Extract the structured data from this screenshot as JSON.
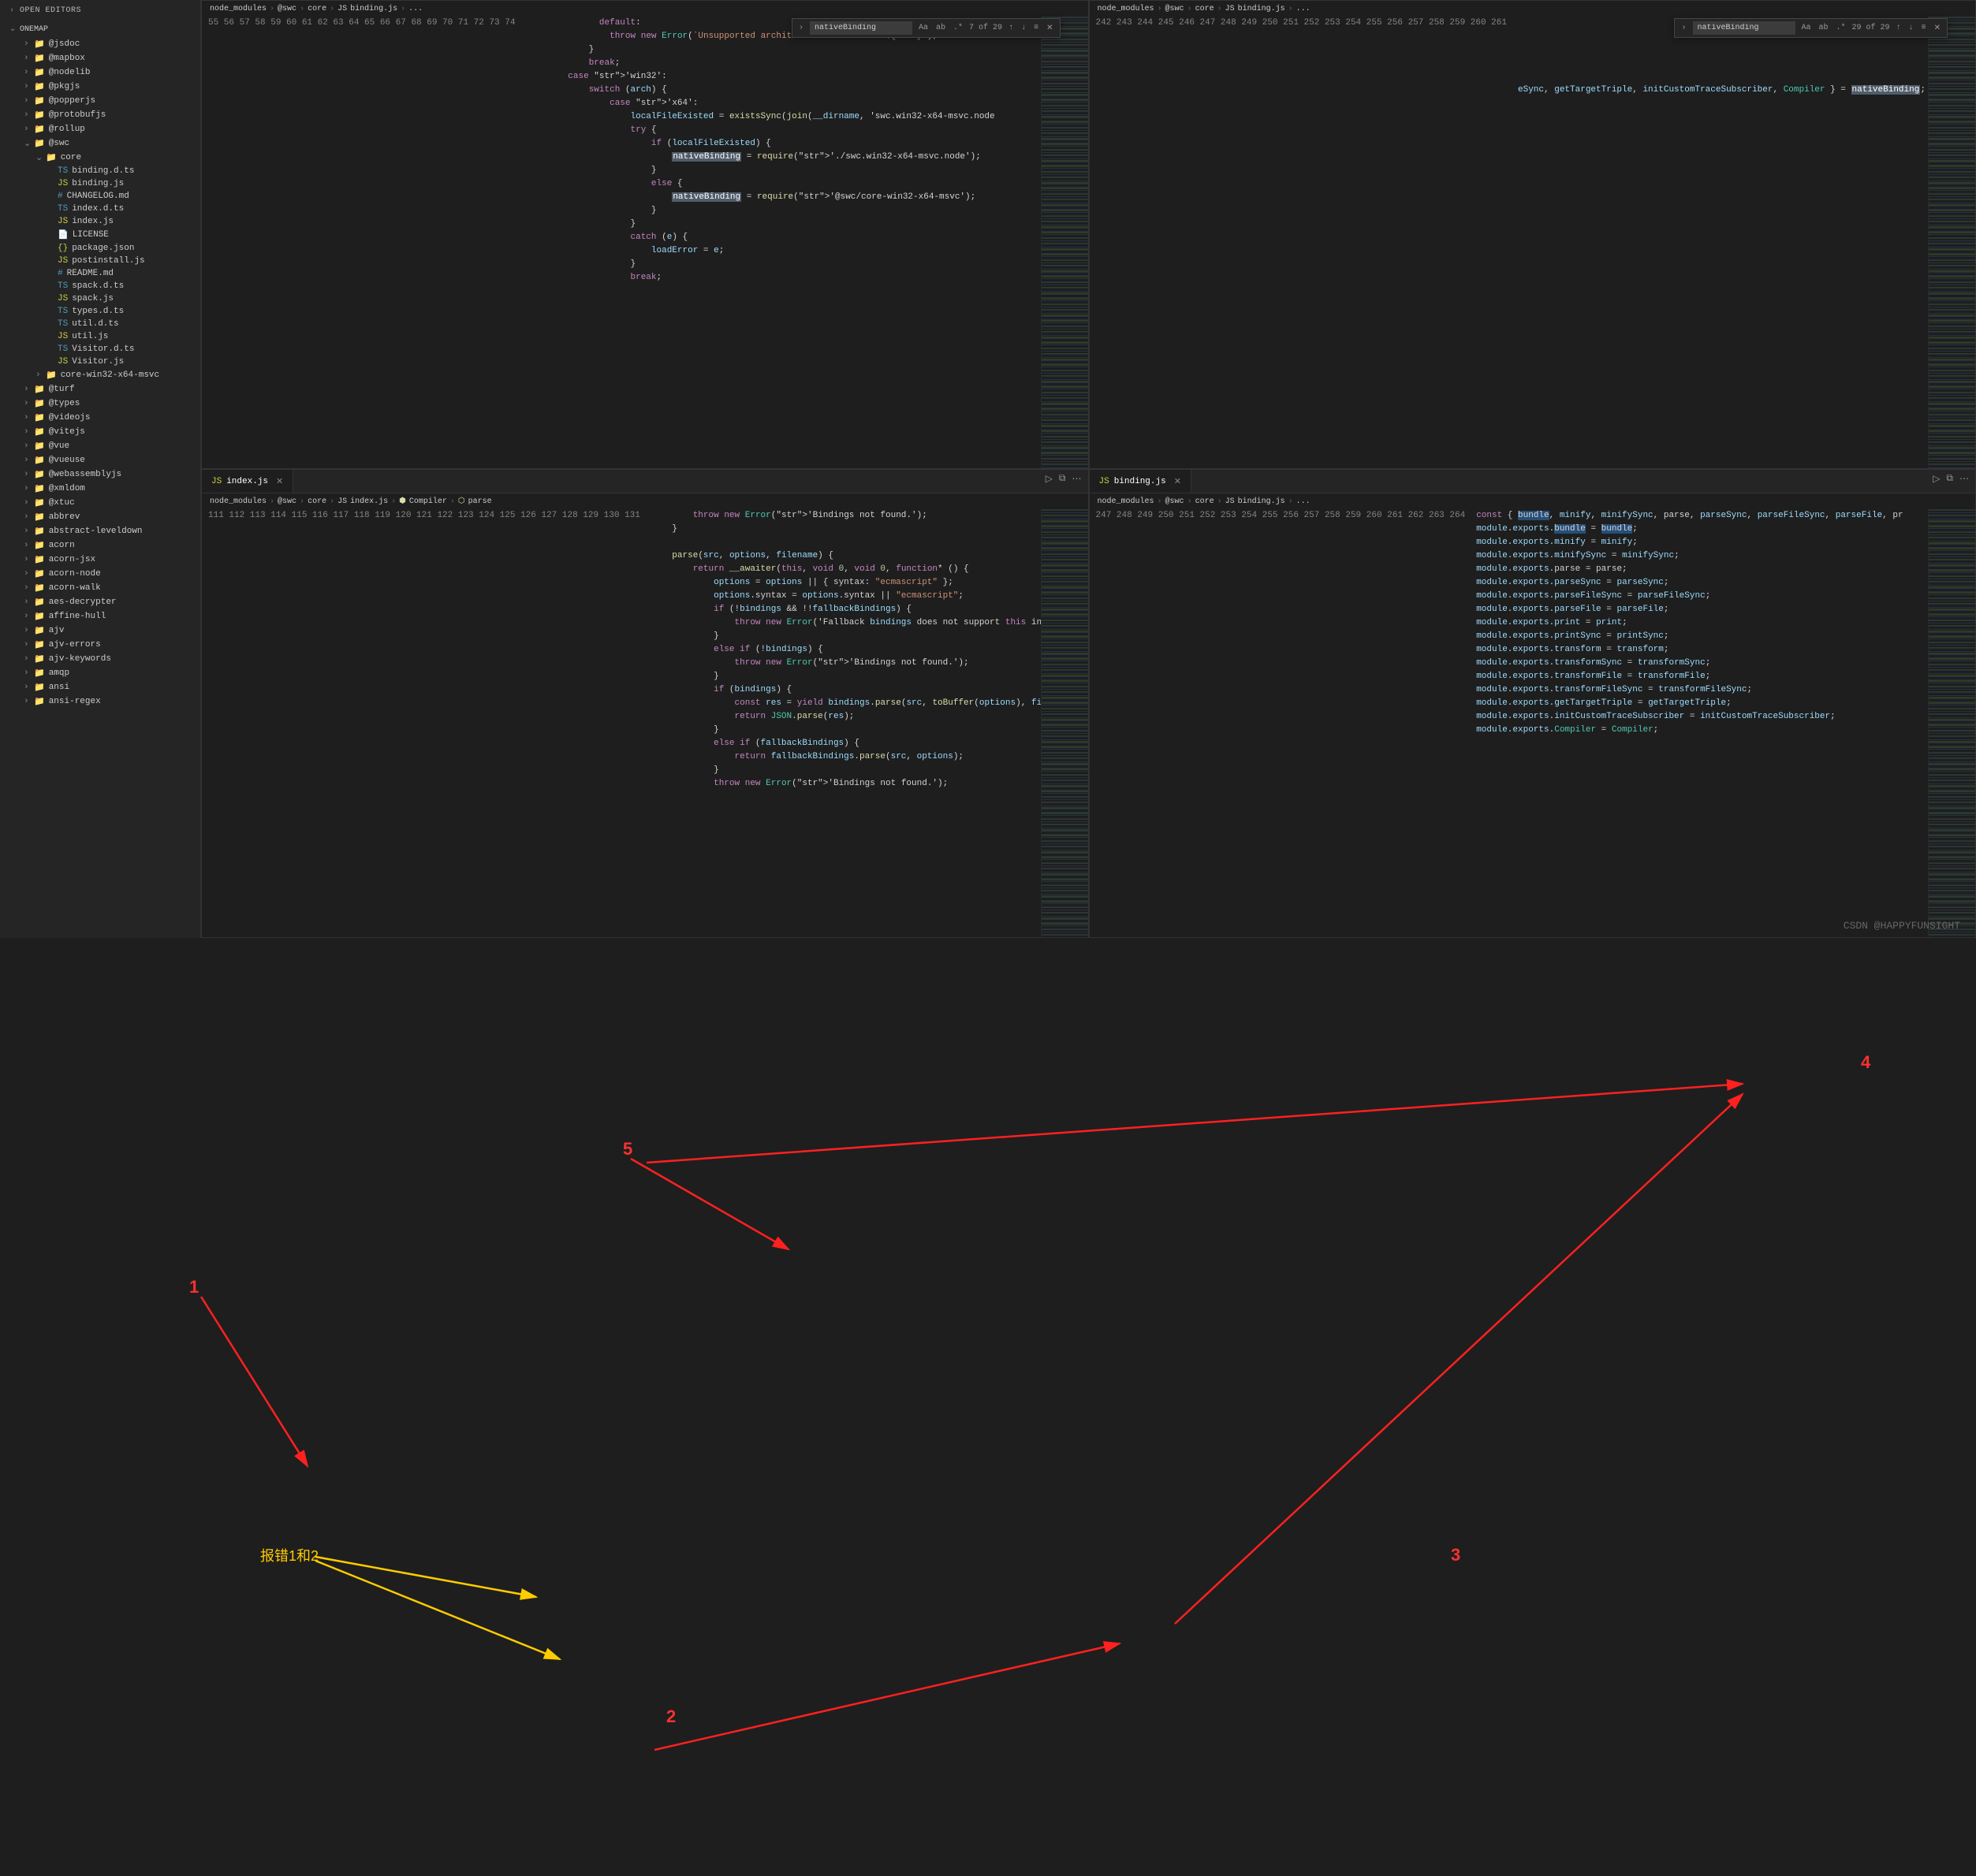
{
  "sidebar": {
    "open_editors": "OPEN EDITORS",
    "section": "ONEMAP",
    "items": [
      {
        "t": "folder",
        "n": "@jsdoc",
        "d": 1
      },
      {
        "t": "folder",
        "n": "@mapbox",
        "d": 1
      },
      {
        "t": "folder",
        "n": "@nodelib",
        "d": 1
      },
      {
        "t": "folder",
        "n": "@pkgjs",
        "d": 1
      },
      {
        "t": "folder",
        "n": "@popperjs",
        "d": 1
      },
      {
        "t": "folder",
        "n": "@protobufjs",
        "d": 1
      },
      {
        "t": "folder",
        "n": "@rollup",
        "d": 1
      },
      {
        "t": "folder",
        "n": "@swc",
        "d": 1,
        "open": true
      },
      {
        "t": "folder",
        "n": "core",
        "d": 2,
        "open": true
      },
      {
        "t": "ts",
        "n": "binding.d.ts",
        "d": 3
      },
      {
        "t": "js",
        "n": "binding.js",
        "d": 3
      },
      {
        "t": "md",
        "n": "CHANGELOG.md",
        "d": 3
      },
      {
        "t": "ts",
        "n": "index.d.ts",
        "d": 3
      },
      {
        "t": "js",
        "n": "index.js",
        "d": 3
      },
      {
        "t": "txt",
        "n": "LICENSE",
        "d": 3
      },
      {
        "t": "json",
        "n": "package.json",
        "d": 3
      },
      {
        "t": "js",
        "n": "postinstall.js",
        "d": 3
      },
      {
        "t": "md",
        "n": "README.md",
        "d": 3
      },
      {
        "t": "ts",
        "n": "spack.d.ts",
        "d": 3
      },
      {
        "t": "js",
        "n": "spack.js",
        "d": 3
      },
      {
        "t": "ts",
        "n": "types.d.ts",
        "d": 3
      },
      {
        "t": "ts",
        "n": "util.d.ts",
        "d": 3
      },
      {
        "t": "js",
        "n": "util.js",
        "d": 3
      },
      {
        "t": "ts",
        "n": "Visitor.d.ts",
        "d": 3
      },
      {
        "t": "js",
        "n": "Visitor.js",
        "d": 3
      },
      {
        "t": "folder",
        "n": "core-win32-x64-msvc",
        "d": 2
      },
      {
        "t": "folder",
        "n": "@turf",
        "d": 1
      },
      {
        "t": "folder",
        "n": "@types",
        "d": 1
      },
      {
        "t": "folder",
        "n": "@videojs",
        "d": 1
      },
      {
        "t": "folder",
        "n": "@vitejs",
        "d": 1
      },
      {
        "t": "folder",
        "n": "@vue",
        "d": 1
      },
      {
        "t": "folder",
        "n": "@vueuse",
        "d": 1
      },
      {
        "t": "folder",
        "n": "@webassemblyjs",
        "d": 1
      },
      {
        "t": "folder",
        "n": "@xmldom",
        "d": 1
      },
      {
        "t": "folder",
        "n": "@xtuc",
        "d": 1
      },
      {
        "t": "folder",
        "n": "abbrev",
        "d": 1
      },
      {
        "t": "folder",
        "n": "abstract-leveldown",
        "d": 1
      },
      {
        "t": "folder",
        "n": "acorn",
        "d": 1
      },
      {
        "t": "folder",
        "n": "acorn-jsx",
        "d": 1
      },
      {
        "t": "folder",
        "n": "acorn-node",
        "d": 1
      },
      {
        "t": "folder",
        "n": "acorn-walk",
        "d": 1
      },
      {
        "t": "folder",
        "n": "aes-decrypter",
        "d": 1
      },
      {
        "t": "folder",
        "n": "affine-hull",
        "d": 1
      },
      {
        "t": "folder",
        "n": "ajv",
        "d": 1
      },
      {
        "t": "folder",
        "n": "ajv-errors",
        "d": 1
      },
      {
        "t": "folder",
        "n": "ajv-keywords",
        "d": 1
      },
      {
        "t": "folder",
        "n": "amqp",
        "d": 1
      },
      {
        "t": "folder",
        "n": "ansi",
        "d": 1
      },
      {
        "t": "folder",
        "n": "ansi-regex",
        "d": 1
      }
    ]
  },
  "panes": {
    "tl": {
      "crumb": [
        "node_modules",
        "@swc",
        "core",
        "binding.js",
        "..."
      ],
      "find": {
        "term": "nativeBinding",
        "count": "7 of 29"
      },
      "start": 55,
      "lines": [
        "              default:",
        "                throw new Error(`Unsupported architecture on Android ${arch}`);",
        "            }",
        "            break;",
        "        case 'win32':",
        "            switch (arch) {",
        "                case 'x64':",
        "                    localFileExisted = existsSync(join(__dirname, 'swc.win32-x64-msvc.node",
        "                    try {",
        "                        if (localFileExisted) {",
        "                            nativeBinding = require('./swc.win32-x64-msvc.node');",
        "                        }",
        "                        else {",
        "                            nativeBinding = require('@swc/core-win32-x64-msvc');",
        "                        }",
        "                    }",
        "                    catch (e) {",
        "                        loadError = e;",
        "                    }",
        "                    break;"
      ]
    },
    "tr": {
      "crumb": [
        "node_modules",
        "@swc",
        "core",
        "binding.js",
        "..."
      ],
      "find": {
        "term": "nativeBinding",
        "count": "29 of 29"
      },
      "start": 242,
      "lines": [
        "",
        "",
        "",
        "",
        "",
        "eSync, getTargetTriple, initCustomTraceSubscriber, Compiler } = nativeBinding;",
        "",
        "",
        "",
        "",
        "",
        "",
        "",
        "",
        "",
        "",
        "",
        "",
        "",
        ""
      ]
    },
    "bl": {
      "tab": "index.js",
      "crumb": [
        "node_modules",
        "@swc",
        "core",
        "index.js",
        "Compiler",
        "parse"
      ],
      "start": 111,
      "lines": [
        "        throw new Error('Bindings not found.');",
        "    }",
        "",
        "    parse(src, options, filename) {",
        "        return __awaiter(this, void 0, void 0, function* () {",
        "            options = options || { syntax: \"ecmascript\" };",
        "            options.syntax = options.syntax || \"ecmascript\";",
        "            if (!bindings && !!fallbackBindings) {",
        "                throw new Error('Fallback bindings does not support this interface",
        "            }",
        "            else if (!bindings) {",
        "                throw new Error('Bindings not found.');",
        "            }",
        "            if (bindings) {",
        "                const res = yield bindings.parse(src, toBuffer(options), filename)",
        "                return JSON.parse(res);",
        "            }",
        "            else if (fallbackBindings) {",
        "                return fallbackBindings.parse(src, options);",
        "            }",
        "            throw new Error('Bindings not found.');"
      ]
    },
    "br": {
      "tab": "binding.js",
      "crumb": [
        "node_modules",
        "@swc",
        "core",
        "binding.js",
        "..."
      ],
      "start": 247,
      "lines": [
        "const { bundle, minify, minifySync, parse, parseSync, parseFileSync, parseFile, pr",
        "module.exports.bundle = bundle;",
        "module.exports.minify = minify;",
        "module.exports.minifySync = minifySync;",
        "module.exports.parse = parse;",
        "module.exports.parseSync = parseSync;",
        "module.exports.parseFileSync = parseFileSync;",
        "module.exports.parseFile = parseFile;",
        "module.exports.print = print;",
        "module.exports.printSync = printSync;",
        "module.exports.transform = transform;",
        "module.exports.transformSync = transformSync;",
        "module.exports.transformFile = transformFile;",
        "module.exports.transformFileSync = transformFileSync;",
        "module.exports.getTargetTriple = getTargetTriple;",
        "module.exports.initCustomTraceSubscriber = initCustomTraceSubscriber;",
        "module.exports.Compiler = Compiler;",
        ""
      ]
    }
  },
  "annotations": {
    "nums": [
      "1",
      "2",
      "3",
      "4",
      "5"
    ],
    "text": "报错1和2"
  },
  "watermark": "CSDN @HAPPYFUNSIGHT"
}
